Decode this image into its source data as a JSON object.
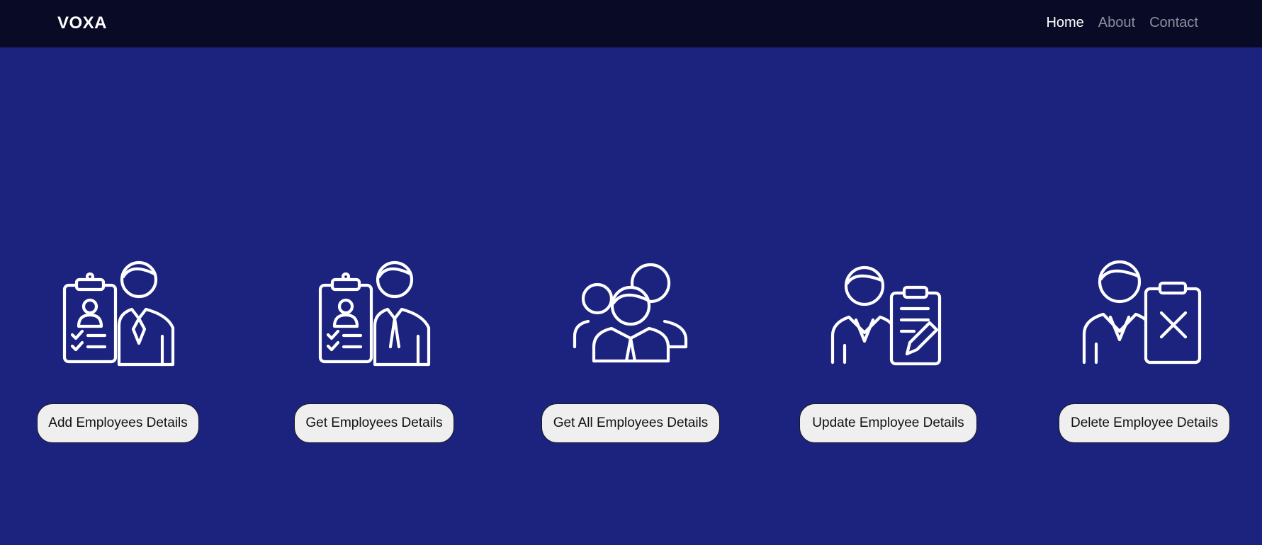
{
  "header": {
    "brand": "VOXA",
    "nav": [
      {
        "label": "Home",
        "active": true
      },
      {
        "label": "About",
        "active": false
      },
      {
        "label": "Contact",
        "active": false
      }
    ]
  },
  "actions": [
    {
      "label": "Add Employees Details",
      "icon": "employee-clipboard-checklist-icon"
    },
    {
      "label": "Get Employees Details",
      "icon": "employee-profile-clipboard-icon"
    },
    {
      "label": "Get All Employees Details",
      "icon": "employee-group-icon"
    },
    {
      "label": "Update Employee Details",
      "icon": "employee-edit-clipboard-icon"
    },
    {
      "label": "Delete Employee Details",
      "icon": "employee-delete-clipboard-icon"
    }
  ],
  "colors": {
    "navbar_bg": "#090a26",
    "page_bg": "#1b237e",
    "nav_active": "#ffffff",
    "nav_inactive": "#8c8d9e",
    "button_bg": "#efefef"
  }
}
